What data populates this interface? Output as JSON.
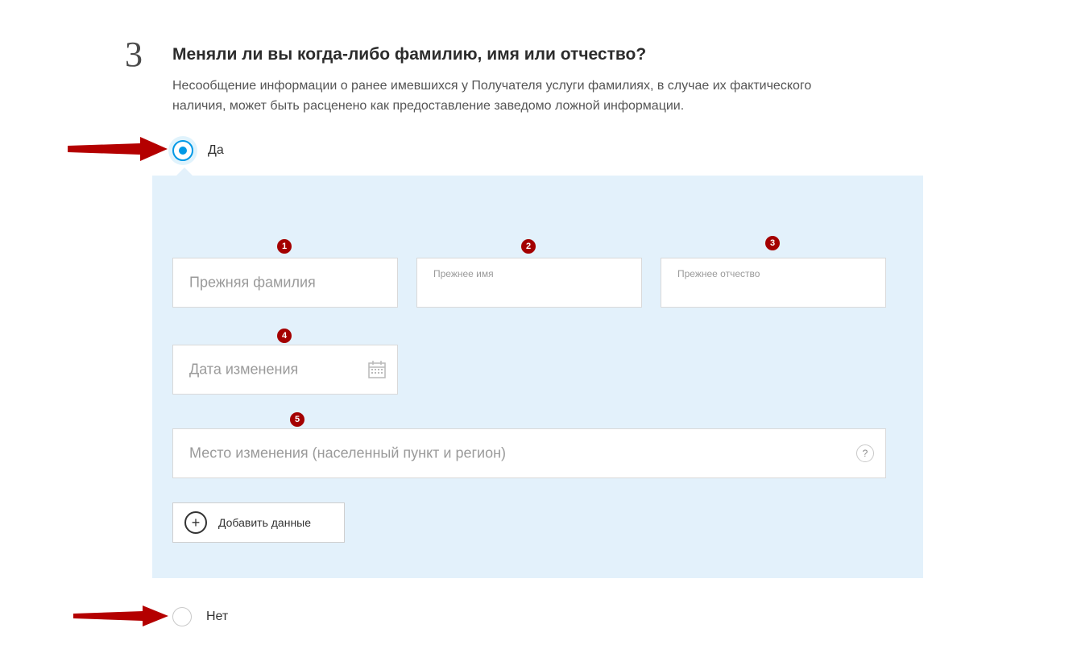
{
  "step": {
    "number": "3"
  },
  "question": {
    "title": "Меняли ли вы когда-либо фамилию, имя или отчество?",
    "description": "Несообщение информации о ранее имевшихся у Получателя услуги фамилиях, в случае их фактического наличия, может быть расценено как предоставление заведомо ложной информации."
  },
  "radios": {
    "yes": {
      "label": "Да",
      "selected": true
    },
    "no": {
      "label": "Нет",
      "selected": false
    }
  },
  "fields": {
    "prev_surname": {
      "placeholder": "Прежняя фамилия"
    },
    "prev_name": {
      "placeholder": "Прежнее имя"
    },
    "prev_patronymic": {
      "placeholder": "Прежнее отчество"
    },
    "change_date": {
      "placeholder": "Дата изменения"
    },
    "change_place": {
      "placeholder": "Место изменения (населенный пункт и регион)"
    }
  },
  "badges": {
    "b1": "1",
    "b2": "2",
    "b3": "3",
    "b4": "4",
    "b5": "5"
  },
  "buttons": {
    "add_data": "Добавить данные"
  },
  "icons": {
    "help": "?"
  }
}
